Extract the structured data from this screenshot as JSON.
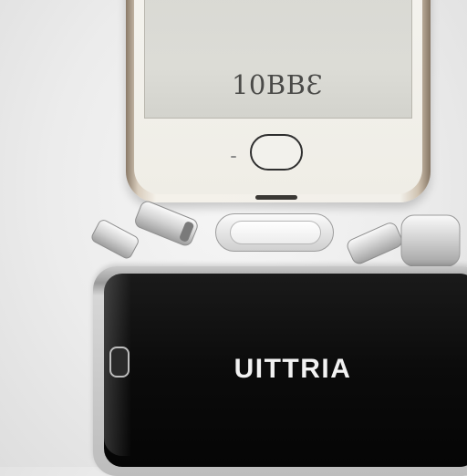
{
  "phone_top": {
    "screen_text": "10BBƐ"
  },
  "device_bottom": {
    "brand_text": "UITTRIA"
  },
  "colors": {
    "background": "#ececec",
    "phone_body": "#f2f0ea",
    "phone_frame": "#8a7a68",
    "phone_screen": "#d9d9d4",
    "device_body": "#0b0b0b",
    "device_text": "#f2f2f2"
  }
}
